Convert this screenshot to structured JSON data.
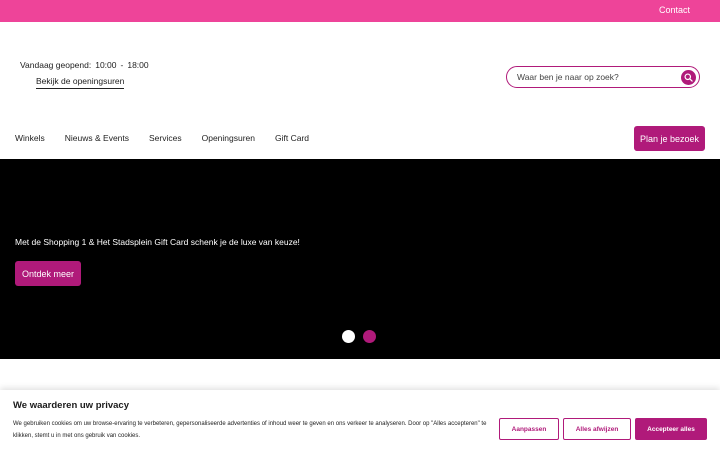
{
  "topbar": {
    "contact": "Contact"
  },
  "header": {
    "hours_label": "Vandaag geopend:",
    "hours_open": "10:00",
    "hours_sep": "-",
    "hours_close": "18:00",
    "hours_link": "Bekijk de openingsuren",
    "search_placeholder": "Waar ben je naar op zoek?"
  },
  "nav": {
    "items": [
      "Winkels",
      "Nieuws & Events",
      "Services",
      "Openingsuren",
      "Gift Card"
    ],
    "cta": "Plan je bezoek"
  },
  "hero": {
    "text": "Met de Shopping 1 & Het Stadsplein Gift Card schenk je de luxe van keuze!",
    "button": "Ontdek meer"
  },
  "cookie": {
    "title": "We waarderen uw privacy",
    "text": "We gebruiken cookies om uw browse-ervaring te verbeteren, gepersonaliseerde advertenties of inhoud weer te geven en ons verkeer te analyseren. Door op \"Alles accepteren\" te klikken, stemt u in met ons gebruik van cookies.",
    "customize": "Aanpassen",
    "reject": "Alles afwijzen",
    "accept": "Accepteer alles"
  },
  "colors": {
    "pink_bar": "#ee4499",
    "brand": "#b01a7a",
    "hero_bg": "#000000"
  }
}
